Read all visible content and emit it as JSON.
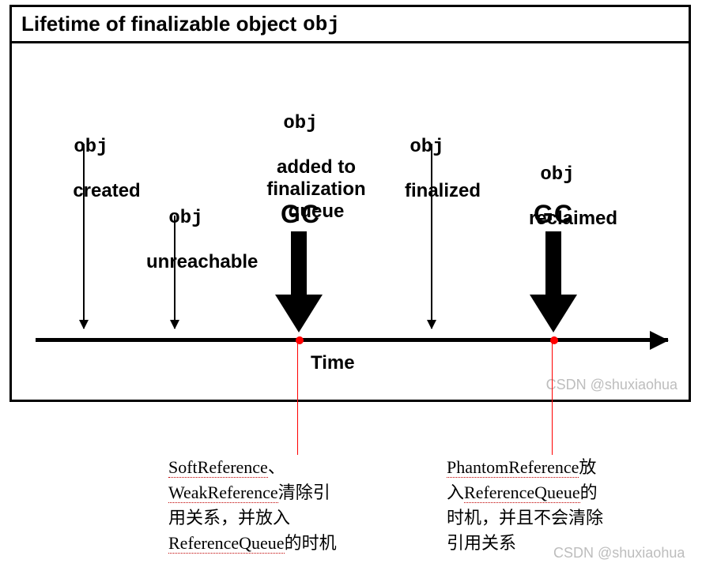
{
  "title": {
    "prefix": "Lifetime of finalizable object",
    "obj": "obj"
  },
  "events": {
    "created": {
      "obj": "obj",
      "text": "created"
    },
    "unreachable": {
      "obj": "obj",
      "text": "unreachable"
    },
    "added": {
      "obj": "obj",
      "line1": "added to",
      "line2": "finalization",
      "line3": "queue"
    },
    "finalized": {
      "obj": "obj",
      "text": "finalized"
    },
    "reclaimed": {
      "obj": "obj",
      "text": "reclaimed"
    },
    "gc1": "GC",
    "gc2": "GC",
    "time": "Time"
  },
  "watermark1": "CSDN @shuxiaohua",
  "watermark2": "CSDN @shuxiaohua",
  "annotations": {
    "left": {
      "p1a": "SoftReference",
      "p1sep": "、",
      "p2a": "WeakReference",
      "p2b": "清除引",
      "p3": "用关系，并放入",
      "p4a": "ReferenceQueue",
      "p4b": "的时机"
    },
    "right": {
      "p1a": "PhantomReference",
      "p1b": "放",
      "p2a": "入",
      "p2b": "ReferenceQueue",
      "p2c": "的",
      "p3": "时机，并且不会清除",
      "p4": "引用关系"
    }
  }
}
